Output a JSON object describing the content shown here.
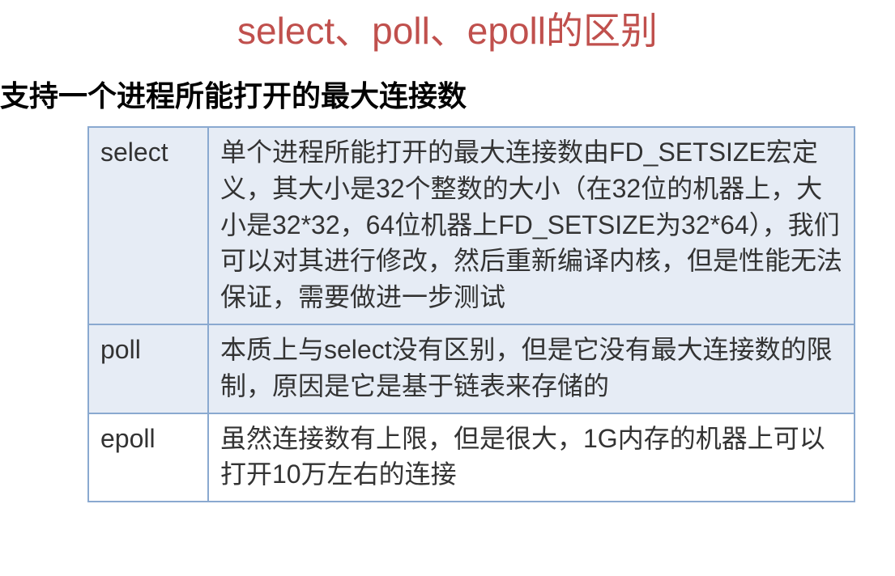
{
  "title": "select、poll、epoll的区别",
  "subtitle": "支持一个进程所能打开的最大连接数",
  "rows": [
    {
      "label": "select",
      "desc": "单个进程所能打开的最大连接数由FD_SETSIZE宏定义，其大小是32个整数的大小（在32位的机器上，大小是32*32，64位机器上FD_SETSIZE为32*64），我们可以对其进行修改，然后重新编译内核，但是性能无法保证，需要做进一步测试"
    },
    {
      "label": "poll",
      "desc": "本质上与select没有区别，但是它没有最大连接数的限制，原因是它是基于链表来存储的"
    },
    {
      "label": "epoll",
      "desc": "虽然连接数有上限，但是很大，1G内存的机器上可以打开10万左右的连接"
    }
  ]
}
